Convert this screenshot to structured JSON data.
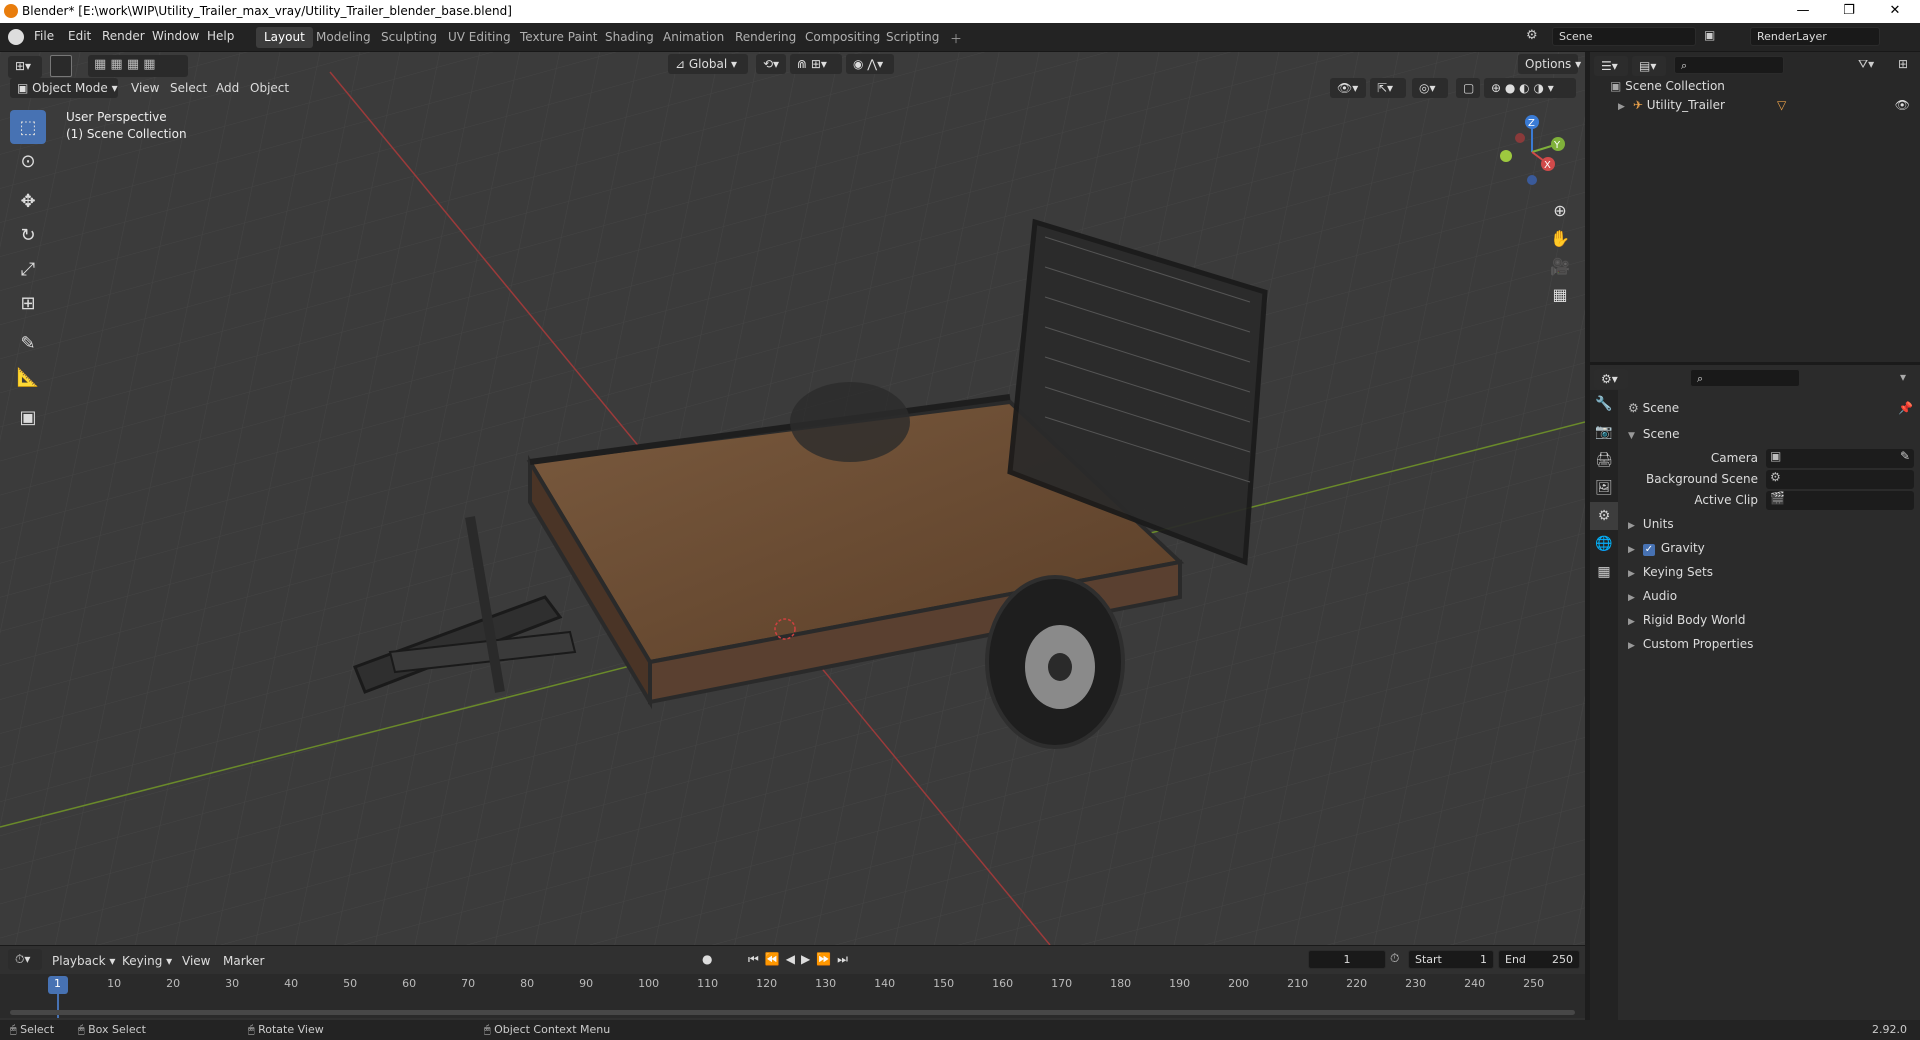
{
  "window": {
    "title": "Blender* [E:\\work\\WIP\\Utility_Trailer_max_vray/Utility_Trailer_blender_base.blend]",
    "minimize": "—",
    "restore": "❐",
    "close": "✕"
  },
  "menu": {
    "file": "File",
    "edit": "Edit",
    "render": "Render",
    "window": "Window",
    "help": "Help"
  },
  "workspaces": [
    "Layout",
    "Modeling",
    "Sculpting",
    "UV Editing",
    "Texture Paint",
    "Shading",
    "Animation",
    "Rendering",
    "Compositing",
    "Scripting"
  ],
  "scene_field": "Scene",
  "renderlayer_field": "RenderLayer",
  "viewport": {
    "mode": "Object Mode",
    "menus": {
      "view": "View",
      "select": "Select",
      "add": "Add",
      "object": "Object"
    },
    "orientation": "Global",
    "options": "Options",
    "perspective": "User Perspective",
    "collection": "(1) Scene Collection",
    "axes": {
      "x": "X",
      "y": "Y",
      "z": "Z"
    }
  },
  "outliner": {
    "root": "Scene Collection",
    "item": "Utility_Trailer"
  },
  "properties": {
    "header": "Scene",
    "panel": "Scene",
    "camera_label": "Camera",
    "bg_scene_label": "Background Scene",
    "active_clip_label": "Active Clip",
    "sections": [
      "Units",
      "Gravity",
      "Keying Sets",
      "Audio",
      "Rigid Body World",
      "Custom Properties"
    ],
    "gravity_checked": true
  },
  "timeline": {
    "playback": "Playback",
    "keying": "Keying",
    "view": "View",
    "marker": "Marker",
    "current_frame": "1",
    "start_label": "Start",
    "start": "1",
    "end_label": "End",
    "end": "250",
    "ticks": [
      "1",
      "10",
      "20",
      "30",
      "40",
      "50",
      "60",
      "70",
      "80",
      "90",
      "100",
      "110",
      "120",
      "130",
      "140",
      "150",
      "160",
      "170",
      "180",
      "190",
      "200",
      "210",
      "220",
      "230",
      "240",
      "250"
    ]
  },
  "statusbar": {
    "select": "Select",
    "box_select": "Box Select",
    "rotate": "Rotate View",
    "context": "Object Context Menu",
    "version": "2.92.0"
  }
}
